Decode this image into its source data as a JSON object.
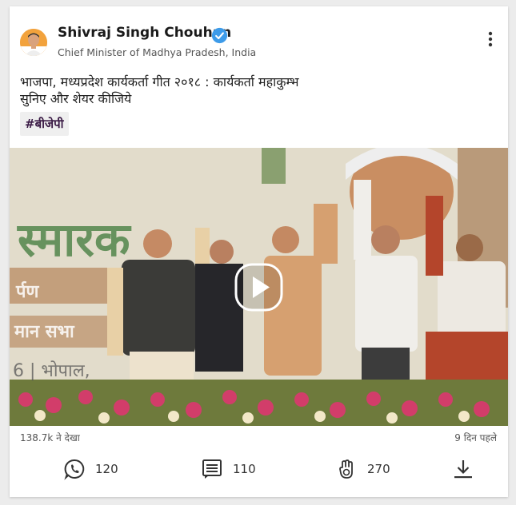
{
  "post": {
    "author": {
      "name": "Shivraj Singh Chouhan",
      "title": "Chief Minister of Madhya Pradesh, India",
      "verified": true
    },
    "text_lines": [
      "भाजपा, मध्यप्रदेश कार्यकर्ता गीत २०१८ : कार्यकर्ता महाकुम्भ",
      "सुनिए और शेयर कीजिये"
    ],
    "hashtag": "#बीजेपी",
    "video": {
      "banner_text": "स्मारक",
      "side_text_1": "र्पण",
      "side_text_2": "मान सभा",
      "side_text_3": "6 | भोपाल,"
    },
    "views": "138.7k ने देखा",
    "time_ago": "9 दिन पहले",
    "actions": {
      "whatsapp_count": "120",
      "comments_count": "110",
      "likes_count": "270"
    }
  },
  "colors": {
    "verified_blue": "#3d9be9",
    "hashtag_text": "#3a1a45",
    "card_bg": "#ffffff",
    "page_bg": "#ececec"
  },
  "icons": [
    "verified-badge-icon",
    "more-vert-icon",
    "play-icon",
    "whatsapp-icon",
    "comment-icon",
    "clap-icon",
    "download-icon"
  ]
}
